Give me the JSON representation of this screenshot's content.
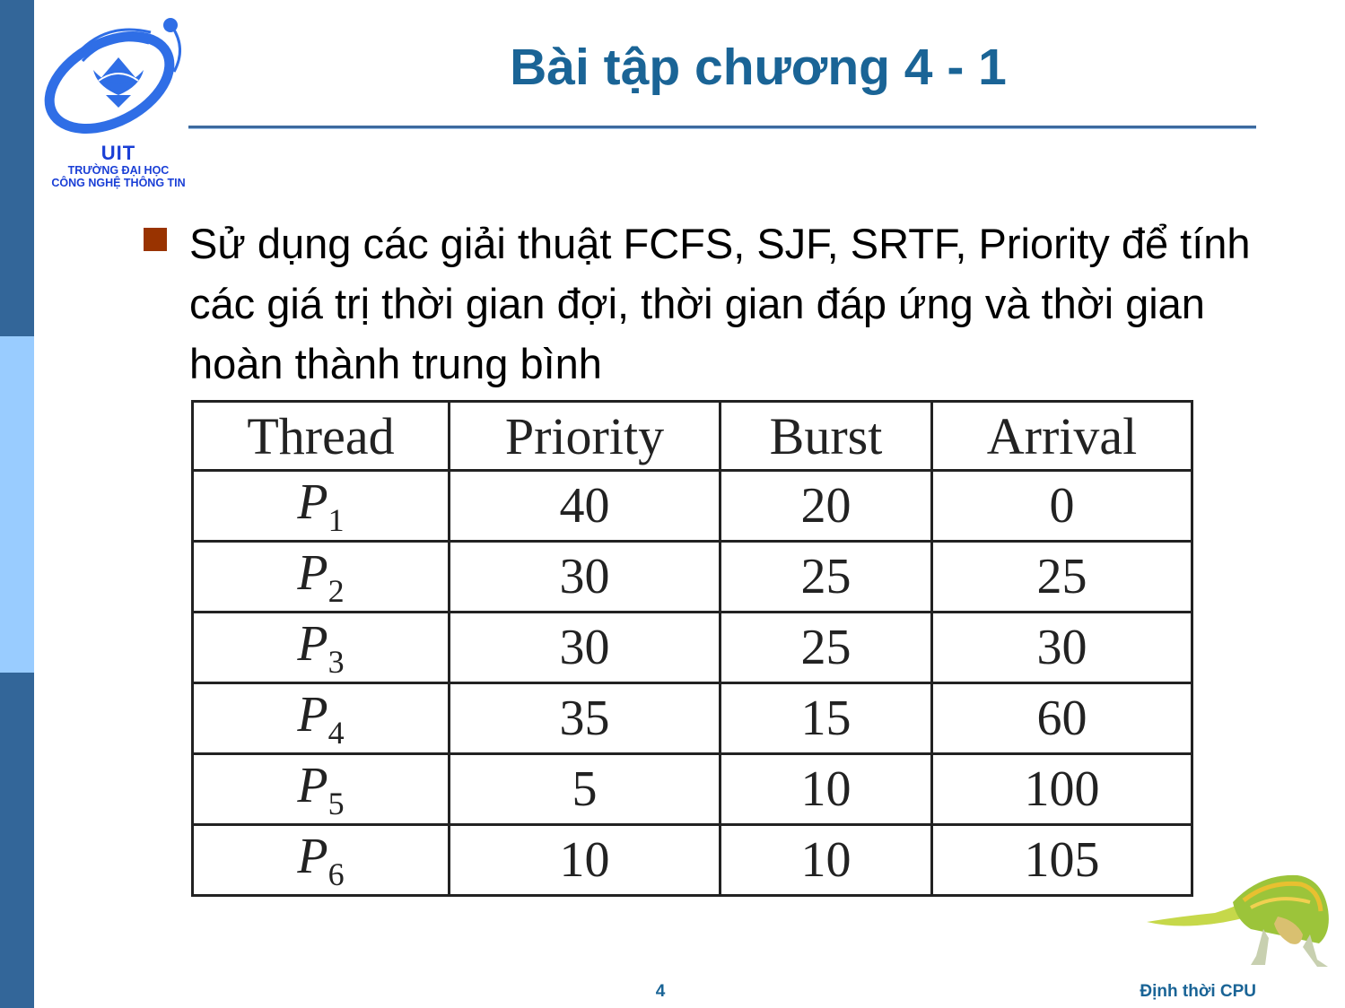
{
  "logo": {
    "abbreviation": "UIT",
    "line1": "TRƯỜNG ĐẠI HỌC",
    "line2": "CÔNG NGHỆ THÔNG TIN"
  },
  "slide": {
    "title": "Bài tập chương 4 - 1",
    "bullet_text": "Sử dụng các giải thuật FCFS, SJF, SRTF, Priority để tính các giá trị thời gian đợi, thời gian đáp ứng và thời gian hoàn thành trung bình"
  },
  "table": {
    "headers": [
      "Thread",
      "Priority",
      "Burst",
      "Arrival"
    ],
    "rows": [
      {
        "thread": "P",
        "sub": "1",
        "priority": "40",
        "burst": "20",
        "arrival": "0"
      },
      {
        "thread": "P",
        "sub": "2",
        "priority": "30",
        "burst": "25",
        "arrival": "25"
      },
      {
        "thread": "P",
        "sub": "3",
        "priority": "30",
        "burst": "25",
        "arrival": "30"
      },
      {
        "thread": "P",
        "sub": "4",
        "priority": "35",
        "burst": "15",
        "arrival": "60"
      },
      {
        "thread": "P",
        "sub": "5",
        "priority": "5",
        "burst": "10",
        "arrival": "100"
      },
      {
        "thread": "P",
        "sub": "6",
        "priority": "10",
        "burst": "10",
        "arrival": "105"
      }
    ]
  },
  "footer": {
    "page_number": "4",
    "section_title": "Định thời CPU"
  },
  "colors": {
    "title_blue": "#1a6496",
    "sidebar_dark": "#336699",
    "sidebar_light": "#99ccff",
    "bullet": "#993300",
    "logo_blue": "#1a3fd6"
  }
}
